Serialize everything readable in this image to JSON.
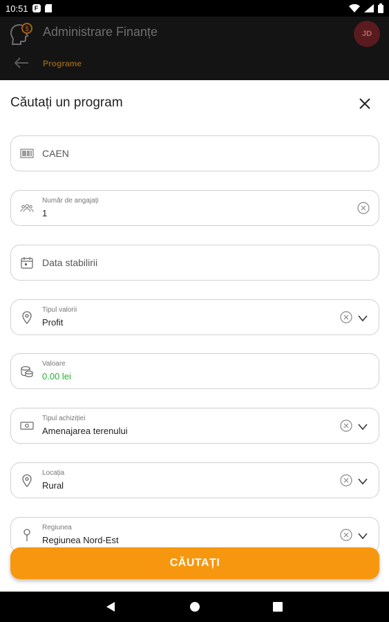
{
  "status": {
    "time": "10:51",
    "badge": "F"
  },
  "header": {
    "title": "Administrare Finanțe",
    "avatar_initials": "JD",
    "breadcrumb": "Programe"
  },
  "dialog": {
    "title": "Căutați un program"
  },
  "fields": {
    "caen": {
      "placeholder": "CAEN"
    },
    "employees": {
      "label": "Număr de angajați",
      "value": "1"
    },
    "date": {
      "placeholder": "Data stabilirii"
    },
    "value_type": {
      "label": "Tipul valorii",
      "value": "Profit"
    },
    "amount": {
      "label": "Valoare",
      "value": "0.00 lei"
    },
    "acquisition": {
      "label": "Tipul achiziției",
      "value": "Amenajarea terenului"
    },
    "location": {
      "label": "Locația",
      "value": "Rural"
    },
    "region": {
      "label": "Regiunea",
      "value": "Regiunea Nord-Est"
    }
  },
  "search_button": {
    "label": "CĂUTAȚI"
  },
  "colors": {
    "accent": "#f7970f",
    "value_green": "#23b033",
    "header_bg": "#141414"
  }
}
